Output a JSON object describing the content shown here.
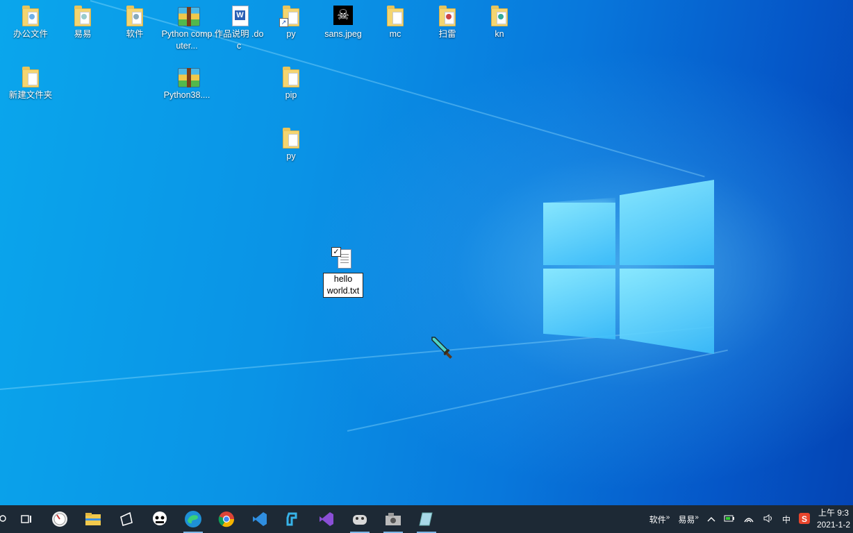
{
  "desktop": {
    "icons": [
      {
        "label": "办公文件",
        "kind": "folder",
        "mark": "#6fb0e8"
      },
      {
        "label": "易易",
        "kind": "folder",
        "mark": "#9cc"
      },
      {
        "label": "软件",
        "kind": "folder",
        "mark": "#8ab"
      },
      {
        "label": "Python computer...",
        "kind": "zip"
      },
      {
        "label": "作品说明 .doc",
        "kind": "doc"
      },
      {
        "label": "py",
        "kind": "folder-shortcut"
      },
      {
        "label": "sans.jpeg",
        "kind": "image"
      },
      {
        "label": "mc",
        "kind": "folder"
      },
      {
        "label": "扫雷",
        "kind": "folder",
        "mark": "#c44"
      },
      {
        "label": "kn",
        "kind": "folder",
        "mark": "#3a9"
      },
      {
        "label": "新建文件夹",
        "kind": "folder"
      },
      {
        "label": "Python38....",
        "kind": "zip"
      },
      {
        "label": "pip",
        "kind": "folder"
      },
      {
        "label": "py",
        "kind": "folder"
      }
    ],
    "renaming_file": {
      "icon": "text-file-icon",
      "value": "hello world.txt"
    }
  },
  "taskbar": {
    "apps": [
      "search-icon",
      "task-view-icon",
      "clock-app-icon",
      "file-explorer-icon",
      "sticky-icon",
      "sans-app-icon",
      "edge-icon",
      "chrome-icon",
      "vscode-icon",
      "python-ide-icon",
      "visual-studio-icon",
      "game-app-icon",
      "camera-app-icon",
      "notes-app-icon"
    ],
    "tray": {
      "toolbar1": "软件",
      "toolbar2": "易易",
      "ime": "中",
      "clock_time": "上午 9:3",
      "clock_date": "2021-1-2"
    }
  }
}
